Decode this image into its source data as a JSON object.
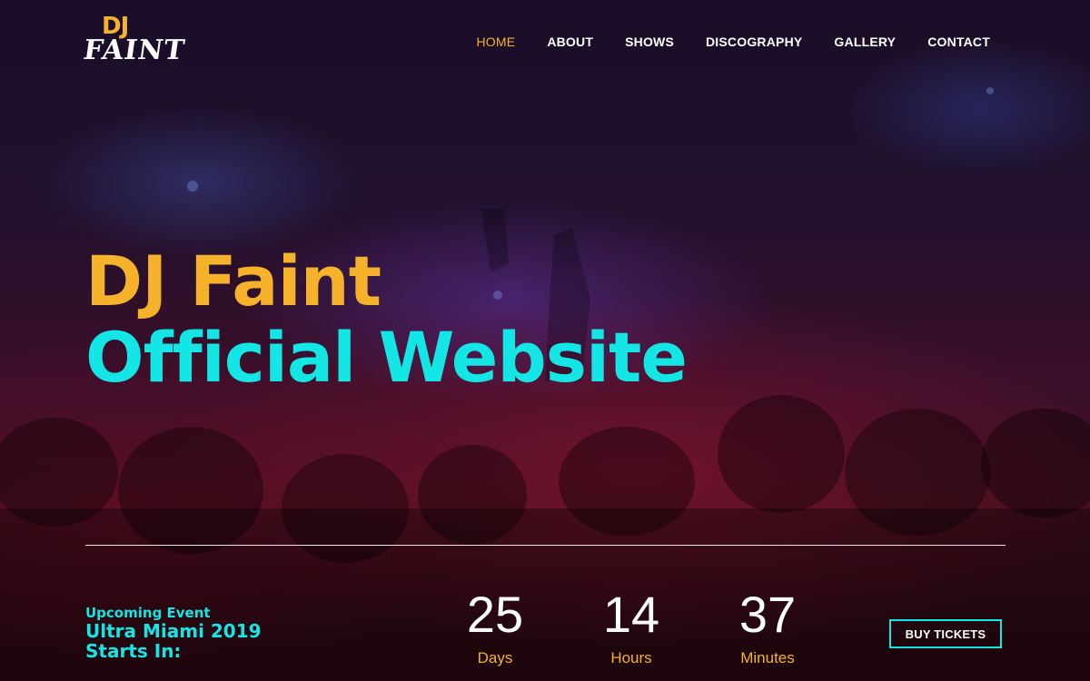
{
  "logo": {
    "top_text": "DJ",
    "bottom_text": "FAINT"
  },
  "nav": {
    "items": [
      {
        "label": "HOME",
        "active": true
      },
      {
        "label": "ABOUT",
        "active": false
      },
      {
        "label": "SHOWS",
        "active": false
      },
      {
        "label": "DISCOGRAPHY",
        "active": false
      },
      {
        "label": "GALLERY",
        "active": false
      },
      {
        "label": "CONTACT",
        "active": false
      }
    ]
  },
  "hero": {
    "line1": "DJ Faint",
    "line2": "Official Website"
  },
  "event": {
    "kicker": "Upcoming Event",
    "title_line1": "Ultra Miami 2019",
    "title_line2": "Starts In:"
  },
  "countdown": [
    {
      "value": "25",
      "label": "Days"
    },
    {
      "value": "14",
      "label": "Hours"
    },
    {
      "value": "37",
      "label": "Minutes"
    }
  ],
  "cta": {
    "label": "BUY TICKETS"
  },
  "colors": {
    "accent_yellow": "#f6b22b",
    "accent_cyan": "#14e6e6",
    "text_white": "#ffffff"
  }
}
